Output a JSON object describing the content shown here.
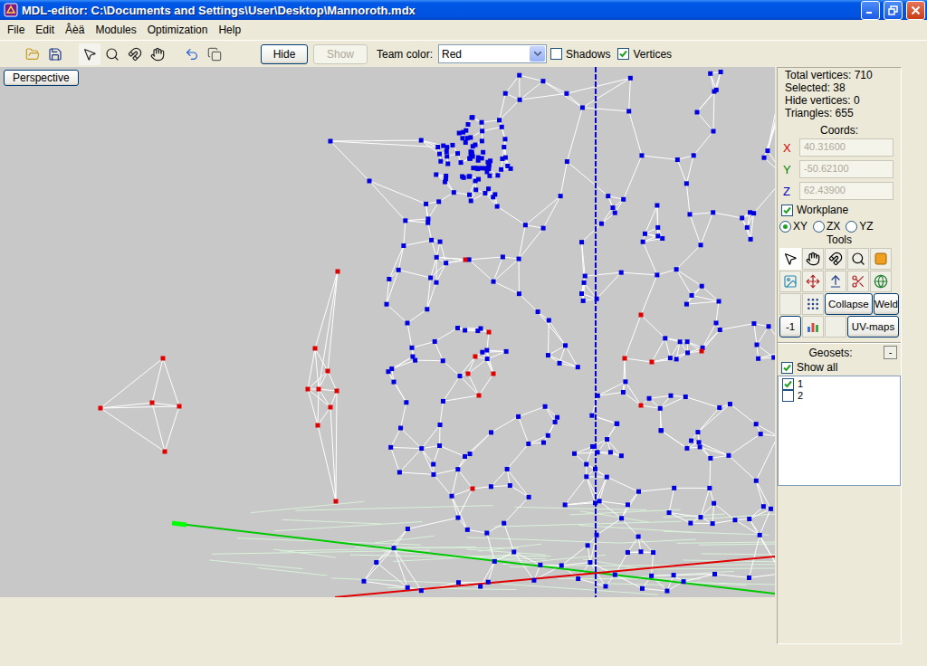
{
  "window": {
    "title": "MDL-editor: C:\\Documents and Settings\\User\\Desktop\\Mannoroth.mdx"
  },
  "menu": [
    "File",
    "Edit",
    "Âèä",
    "Modules",
    "Optimization",
    "Help"
  ],
  "toolbar": {
    "tool_groups": [
      [
        {
          "kind": "open",
          "selected": false
        },
        {
          "kind": "save",
          "selected": false
        }
      ],
      [
        {
          "kind": "select",
          "selected": true
        },
        {
          "kind": "zoom",
          "selected": false
        },
        {
          "kind": "rotate",
          "selected": false
        },
        {
          "kind": "hand",
          "selected": false
        }
      ],
      [
        {
          "kind": "undo",
          "selected": false
        },
        {
          "kind": "copy",
          "selected": false
        },
        {
          "kind": "empty",
          "selected": false
        }
      ]
    ],
    "hide_button": {
      "label": "Hide",
      "disabled": false
    },
    "show_button": {
      "label": "Show",
      "disabled": true
    },
    "team_color": {
      "label": "Team color:",
      "value": "Red"
    },
    "checkboxes": [
      {
        "label": "Shadows",
        "checked": false
      },
      {
        "label": "Vertices",
        "checked": true
      }
    ]
  },
  "viewport": {
    "view_button": "Perspective"
  },
  "side_panel": {
    "stats": [
      "Total vertices: 710",
      "Selected: 38",
      "Hide vertices: 0",
      "Triangles: 655"
    ],
    "coords": {
      "title": "Coords:",
      "fields": [
        {
          "axis": "X",
          "value": "40.31600",
          "color": "#d40000",
          "disabled": true
        },
        {
          "axis": "Y",
          "value": "-50.62100",
          "color": "#008000",
          "disabled": true
        },
        {
          "axis": "Z",
          "value": "62.43900",
          "color": "#0000c0",
          "disabled": true
        }
      ]
    },
    "workplane": {
      "label": "Workplane",
      "checked": true
    },
    "planes": [
      {
        "label": "XY",
        "selected": true
      },
      {
        "label": "ZX",
        "selected": false
      },
      {
        "label": "YZ",
        "selected": false
      }
    ],
    "tools_title": "Tools",
    "tool_rows": [
      [
        {
          "kind": "select",
          "selected": true
        },
        {
          "kind": "hand",
          "selected": false
        },
        {
          "kind": "rotate",
          "selected": false
        },
        {
          "kind": "zoom",
          "selected": false
        },
        {
          "kind": "color",
          "selected": false
        }
      ],
      [
        {
          "kind": "texture",
          "selected": false
        },
        {
          "kind": "move",
          "selected": false
        },
        {
          "kind": "extrude",
          "selected": false
        },
        {
          "kind": "split",
          "selected": false
        },
        {
          "kind": "sphere",
          "selected": false
        }
      ],
      [
        {
          "kind": "empty",
          "selected": false
        },
        {
          "kind": "dots",
          "selected": false
        },
        {
          "kind": "text",
          "label": "Collapse",
          "selected": false
        },
        {
          "kind": "text",
          "label": "Weld",
          "selected": false
        }
      ],
      [
        {
          "kind": "text",
          "label": "-1",
          "selected": false
        },
        {
          "kind": "chart",
          "selected": false
        },
        {
          "kind": "empty",
          "selected": false
        },
        {
          "kind": "text",
          "label": "UV-maps",
          "selected": false
        }
      ]
    ],
    "geosets": {
      "title": "Geosets:",
      "collapse": "-",
      "show_all": {
        "label": "Show all",
        "checked": true
      },
      "items": [
        {
          "label": "1",
          "checked": true
        },
        {
          "label": "2",
          "checked": false
        }
      ]
    }
  }
}
